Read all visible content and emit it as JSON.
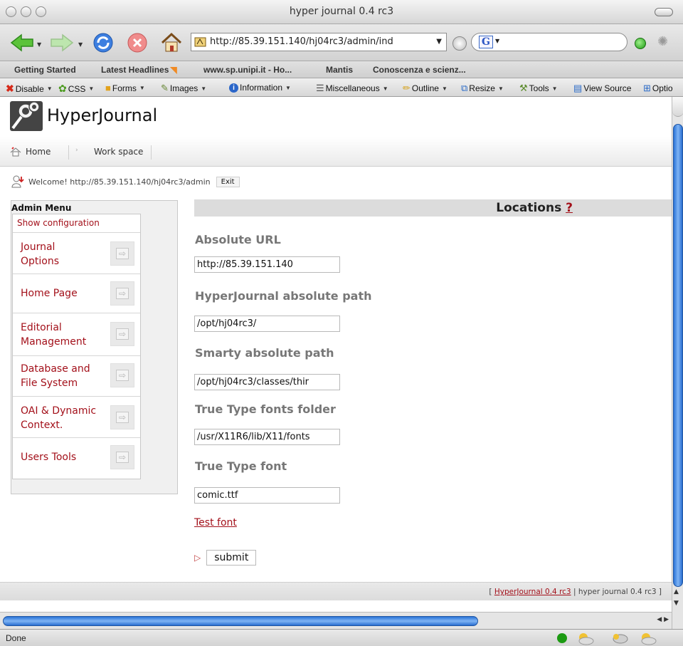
{
  "window": {
    "title": "hyper journal 0.4 rc3"
  },
  "toolbar": {
    "url": "http://85.39.151.140/hj04rc3/admin/ind",
    "search_value": ""
  },
  "bookmarks": [
    "Getting Started",
    "Latest Headlines",
    "www.sp.unipi.it - Ho...",
    "Mantis",
    "Conoscenza e scienz..."
  ],
  "devbar": [
    "Disable",
    "CSS",
    "Forms",
    "Images",
    "Information",
    "Miscellaneous",
    "Outline",
    "Resize",
    "Tools",
    "View Source",
    "Optio"
  ],
  "site": {
    "title": "HyperJournal",
    "breadcrumb": [
      "Home",
      "Work space"
    ],
    "welcome": "Welcome! http://85.39.151.140/hj04rc3/admin",
    "exit_label": "Exit"
  },
  "admin_menu": {
    "title": "Admin Menu",
    "config_link": "Show configuration",
    "items": [
      "Journal Options",
      "Home Page",
      "Editorial Management",
      "Database and File System",
      "OAI & Dynamic Context.",
      "Users Tools"
    ],
    "item_lines": [
      [
        "Journal",
        "Options"
      ],
      [
        "Home Page"
      ],
      [
        "Editorial",
        "Management"
      ],
      [
        "Database and",
        "File System"
      ],
      [
        "OAI & Dynamic",
        "Context."
      ],
      [
        "Users Tools"
      ]
    ]
  },
  "main": {
    "heading": "Locations",
    "help": "?",
    "fields": [
      {
        "label": "Absolute URL",
        "value": "http://85.39.151.140"
      },
      {
        "label": "HyperJournal absolute path",
        "value": "/opt/hj04rc3/"
      },
      {
        "label": "Smarty absolute path",
        "value": "/opt/hj04rc3/classes/thir"
      },
      {
        "label": "True Type fonts folder",
        "value": "/usr/X11R6/lib/X11/fonts"
      },
      {
        "label": "True Type font",
        "value": "comic.ttf"
      }
    ],
    "test_font": "Test font",
    "submit_label": "submit"
  },
  "footer": {
    "open": "[",
    "link": "HyperJournal 0.4 rc3",
    "sep": "|",
    "text": "hyper journal 0.4 rc3",
    "close": "]"
  },
  "status": "Done",
  "colors": {
    "link": "#a3101a",
    "accent": "#2a74d8"
  }
}
